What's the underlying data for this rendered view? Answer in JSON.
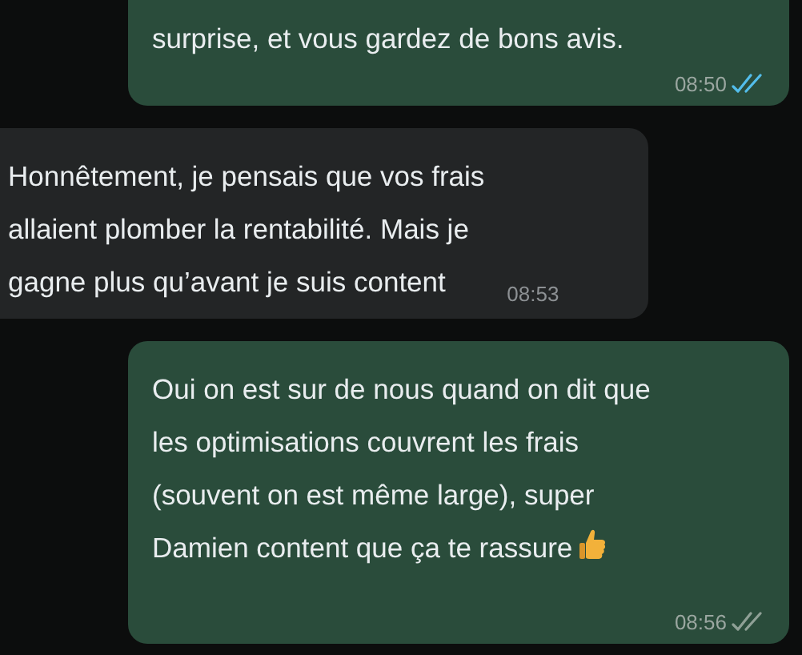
{
  "messages": [
    {
      "kind": "outgoing",
      "text": "surprise, et vous gardez de bons avis.",
      "time": "08:50",
      "read": true,
      "emoji": false
    },
    {
      "kind": "incoming",
      "text": "Honnêtement, je pensais que vos frais\nallaient plomber la rentabilité. Mais je\ngagne plus qu’avant je suis content",
      "time": "08:53"
    },
    {
      "kind": "outgoing",
      "text": "Oui on est sur de nous quand on dit que\nles optimisations couvrent les frais\n(souvent on est même large), super\nDamien content que ça te rassure",
      "time": "08:56",
      "read": false,
      "emoji": true
    }
  ]
}
